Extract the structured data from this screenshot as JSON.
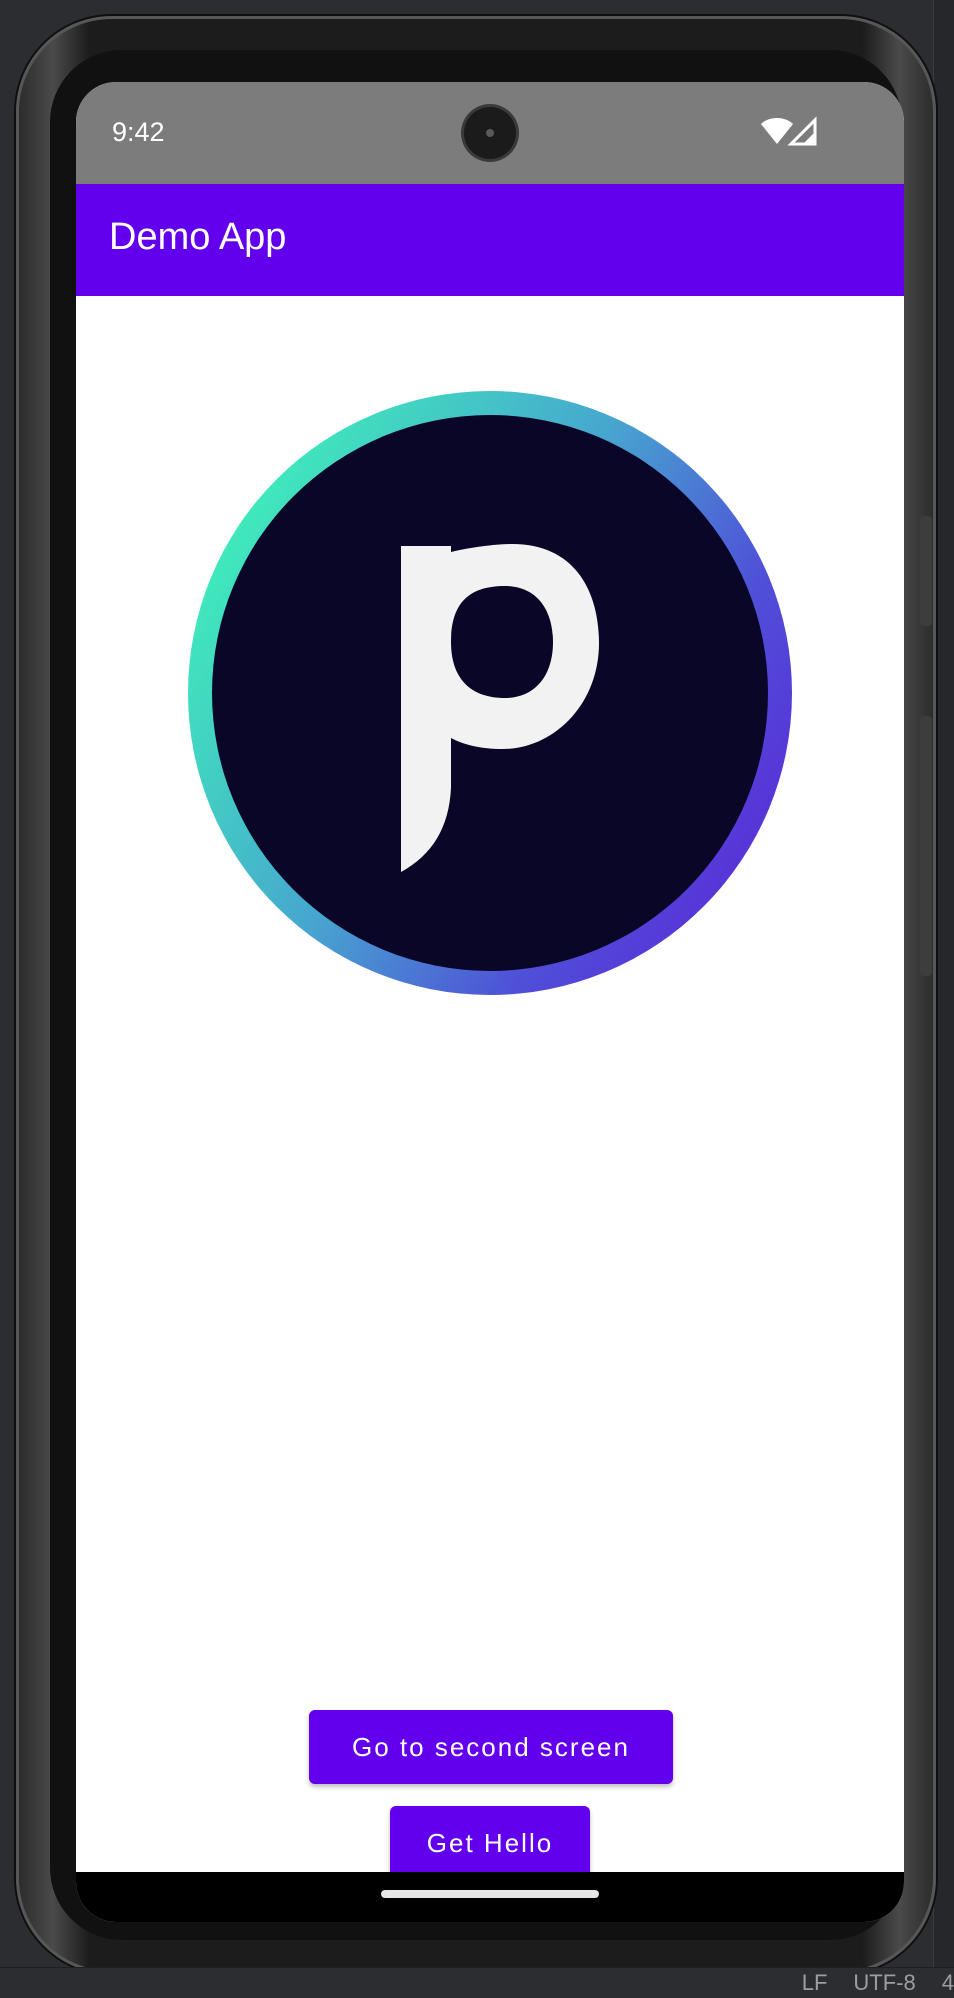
{
  "status_bar": {
    "time": "9:42",
    "icons": [
      "wifi-icon",
      "cell-signal-icon"
    ]
  },
  "app_bar": {
    "title": "Demo App",
    "color": "#6200ee"
  },
  "logo": {
    "letter": "p",
    "ring_colors": [
      "#3ef5b8",
      "#5b2ad8"
    ],
    "fill_color": "#0a0628"
  },
  "buttons": {
    "second_screen": "Go to second screen",
    "get_hello": "Get Hello"
  },
  "ide_status": {
    "items": [
      "LF",
      "UTF-8",
      "4"
    ]
  }
}
